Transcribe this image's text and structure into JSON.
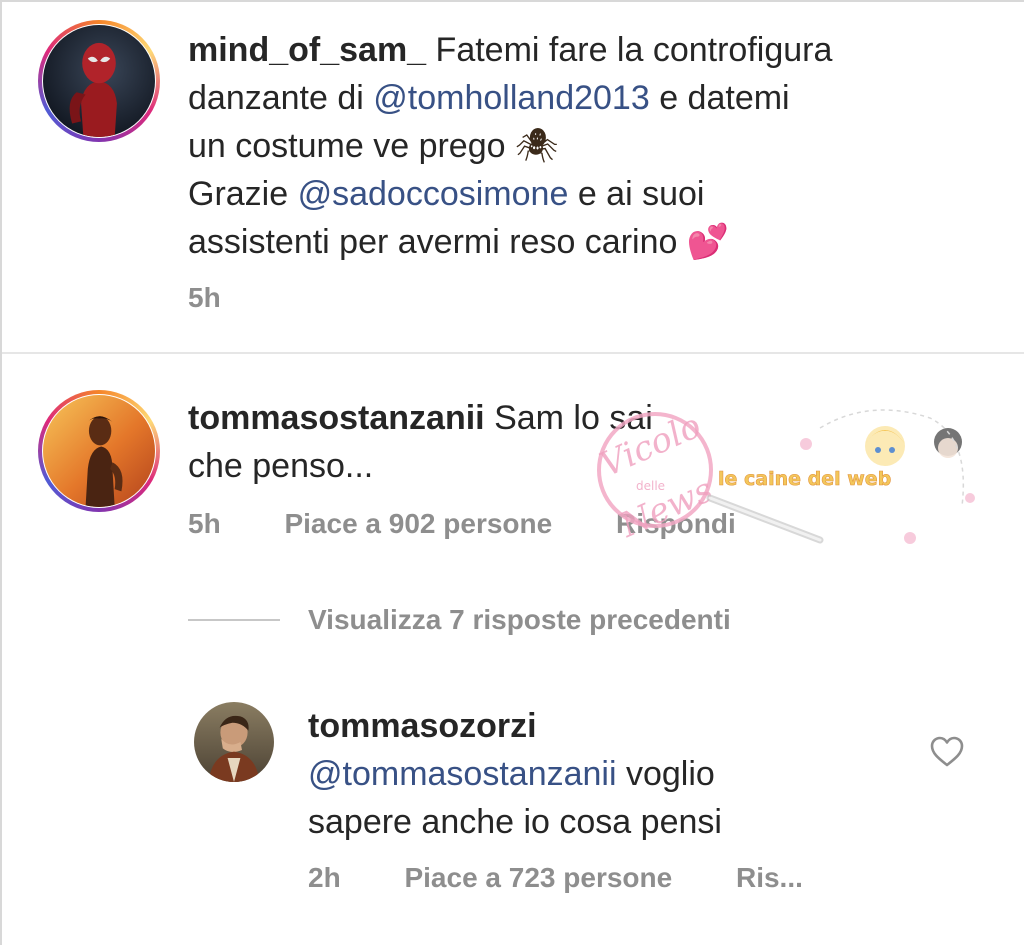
{
  "caption": {
    "username": "mind_of_sam_",
    "line1": "Fatemi fare la controfigura",
    "line2a": "danzante di",
    "mention1": "@tomholland2013",
    "line2b": "e datemi",
    "line3": "un costume ve prego",
    "spider_emoji": "🕷",
    "line4a": "Grazie",
    "mention2": "@sadoccosimone",
    "line4b": "e ai suoi",
    "line5": "assistenti per avermi reso carino",
    "hearts_emoji": "💕",
    "time": "5h"
  },
  "comment1": {
    "username": "tommasostanzanii",
    "text_line1": "Sam lo sai",
    "text_line2": "che penso...",
    "time": "5h",
    "likes": "Piace a 902 persone",
    "reply": "Rispondi"
  },
  "view_replies": "Visualizza 7 risposte precedenti",
  "comment2": {
    "username": "tommasozorzi",
    "mention": "@tommasostanzanii",
    "text_line1": "voglio",
    "text_line2": "sapere anche io cosa pensi",
    "time": "2h",
    "likes": "Piace a 723 persone",
    "reply": "Ris..."
  },
  "watermark": {
    "line1": "Vicolo",
    "line2": "delle",
    "line3": "News",
    "side": "le caine del web"
  },
  "colors": {
    "mention": "#385185",
    "meta": "#8e8e8e",
    "text": "#262626",
    "watermark_pink": "#f2a8c4"
  },
  "icons": {
    "like": "heart-outline-icon"
  }
}
